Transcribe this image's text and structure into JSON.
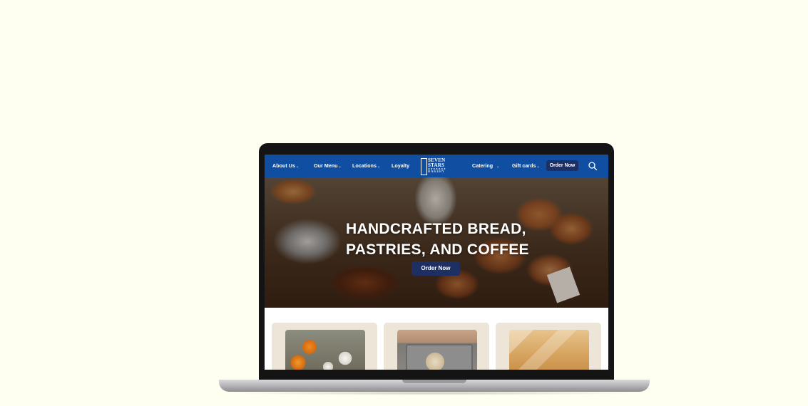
{
  "nav": {
    "items": [
      {
        "label": "About Us",
        "has_dropdown": true
      },
      {
        "label": "Our Menu",
        "has_dropdown": true
      },
      {
        "label": "Locations",
        "has_dropdown": true
      },
      {
        "label": "Loyalty",
        "has_dropdown": false
      },
      {
        "label": "Catering",
        "has_dropdown": true
      },
      {
        "label": "Gift cards",
        "has_dropdown": true
      }
    ],
    "order_label": "Order Now",
    "search_icon": "search-icon",
    "background_color": "#0f4ea0",
    "button_color": "#1d2f63"
  },
  "logo": {
    "line1": "SEVEN",
    "line2": "STARS",
    "stars": "★★★★★★★",
    "line3": "BAKERY"
  },
  "hero": {
    "title_line1": "HANDCRAFTED BREAD,",
    "title_line2": "PASTRIES, AND COFFEE",
    "button_label": "Order Now"
  },
  "cards": [
    {
      "image": "pumpkins"
    },
    {
      "image": "dough-on-tray"
    },
    {
      "image": "pastry-bags"
    }
  ],
  "colors": {
    "page_background": "#fffff1",
    "card_background": "#eee5d9"
  }
}
